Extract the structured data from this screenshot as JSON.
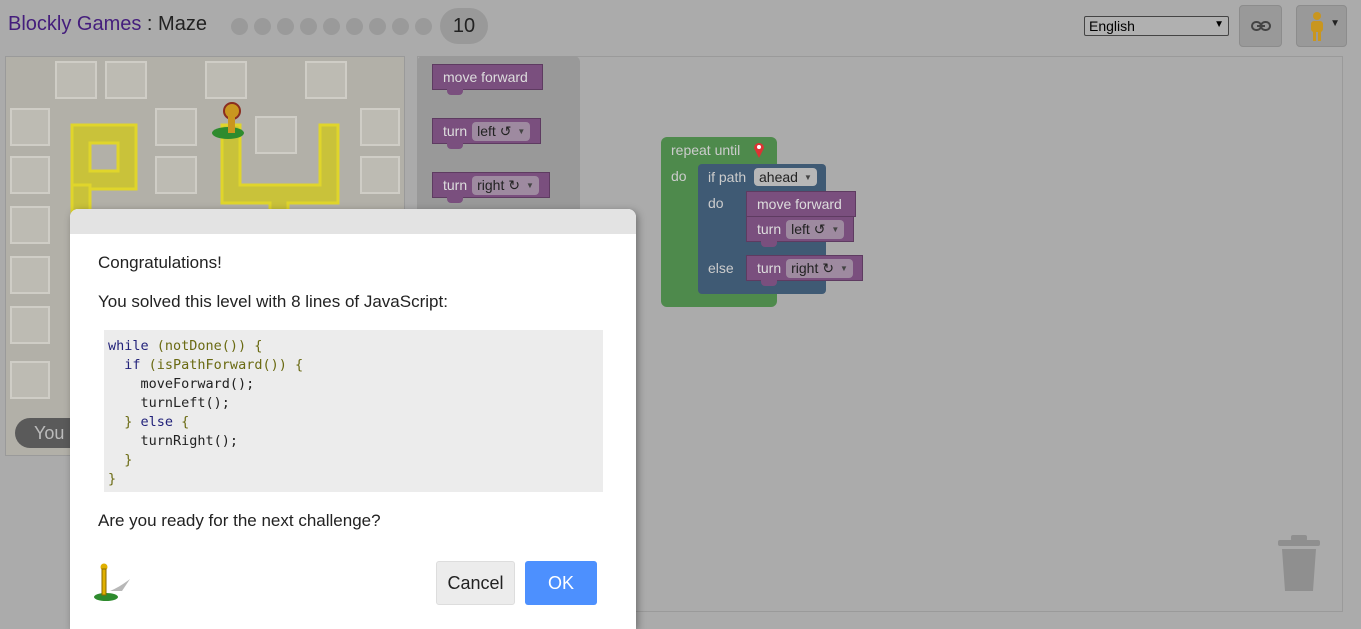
{
  "header": {
    "app_name": "Blockly Games",
    "separator": " : ",
    "game_name": "Maze",
    "current_level": "10",
    "language": "English",
    "link_icon": "link-icon",
    "avatar_icon": "pegman-icon"
  },
  "maze": {
    "status_badge": "You"
  },
  "toolbox": {
    "move_forward": "move forward",
    "turn_label": "turn",
    "left": "left ↺",
    "right": "right ↻"
  },
  "workspace": {
    "repeat_until": "repeat until",
    "do": "do",
    "if_path": "if path",
    "ahead": "ahead",
    "inner_do": "do",
    "move_forward": "move forward",
    "turn_label": "turn",
    "left": "left ↺",
    "else": "else",
    "turn_label2": "turn",
    "right": "right ↻",
    "trash_icon": "trash-icon"
  },
  "dialog": {
    "congrats": "Congratulations!",
    "solved": "You solved this level with 8 lines of JavaScript:",
    "code": {
      "l1_kw": "while",
      "l1_rest": " (notDone()) {",
      "l2_kw": "if",
      "l2_rest": " (isPathForward()) {",
      "l3": "moveForward();",
      "l4": "turnLeft();",
      "l5_a": "}",
      "l5_kw": " else",
      "l5_b": " {",
      "l6": "turnRight();",
      "l7": "}",
      "l8": "}"
    },
    "question": "Are you ready for the next challenge?",
    "cancel": "Cancel",
    "ok": "OK"
  },
  "colors": {
    "background": "#ababab",
    "ok_button": "#4d90fe",
    "block_purple": "#7a4f7e",
    "repeat_green": "#4e8a4c",
    "if_blue": "#3f5a74"
  }
}
